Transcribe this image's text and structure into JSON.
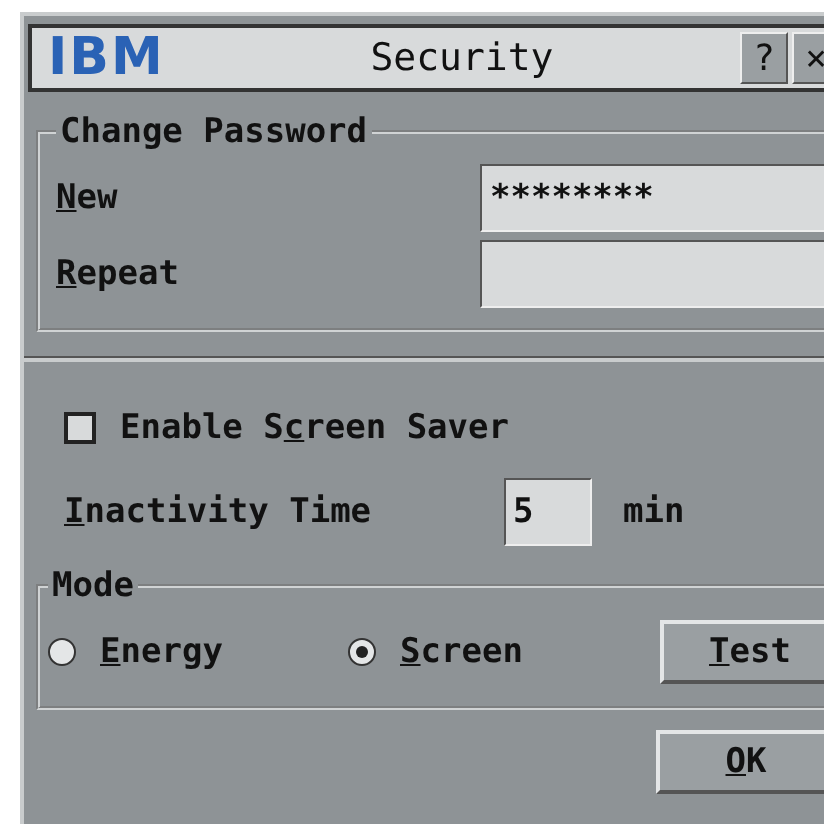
{
  "window": {
    "logo": "IBM",
    "title": "Security",
    "help_button": "?",
    "close_button": "×"
  },
  "change_password": {
    "legend": "Change Password",
    "fields": [
      {
        "label": {
          "key": "N",
          "post": "ew"
        },
        "value": "********"
      },
      {
        "label": {
          "key": "R",
          "post": "epeat"
        }
      }
    ]
  },
  "screen_saver": {
    "label": {
      "pre": "Enable S",
      "key": "c",
      "post": "reen Saver"
    },
    "checked": false
  },
  "inactivity": {
    "label": {
      "key": "I",
      "post": "nactivity Time"
    },
    "value": "5",
    "unit": "min"
  },
  "mode": {
    "legend": "Mode",
    "options": [
      {
        "label": {
          "key": "E",
          "post": "nergy"
        },
        "selected": false
      },
      {
        "label": {
          "key": "S",
          "post": "creen"
        },
        "selected": true
      }
    ],
    "test_button": {
      "key": "T",
      "post": "est"
    }
  },
  "ok_button": {
    "key": "O",
    "post": "K"
  }
}
